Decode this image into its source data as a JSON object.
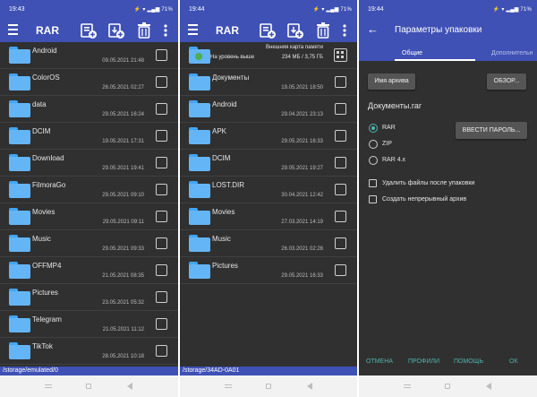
{
  "colors": {
    "primary": "#3f51b5",
    "list_bg": "#303030",
    "accent": "#4db6ac",
    "folder": "#64b5f6"
  },
  "screen1": {
    "status_time": "19:43",
    "status_icons": "⚡ ▾ ▂▄▆ 71%",
    "title": "RAR",
    "toolbar_icons": [
      "menu-icon",
      "add-archive-icon",
      "extract-icon",
      "delete-icon",
      "more-icon"
    ],
    "rows": [
      {
        "name": "Android",
        "date": "09.05.2021 21:48"
      },
      {
        "name": "ColorOS",
        "date": "26.05.2021 02:27"
      },
      {
        "name": "data",
        "date": "29.05.2021 16:24"
      },
      {
        "name": "DCIM",
        "date": "19.05.2021 17:31"
      },
      {
        "name": "Download",
        "date": "29.05.2021 19:41"
      },
      {
        "name": "FilmoraGo",
        "date": "29.05.2021 09:10"
      },
      {
        "name": "Movies",
        "date": "29.05.2021 09:11"
      },
      {
        "name": "Music",
        "date": "29.05.2021 09:33"
      },
      {
        "name": "OFFMP4",
        "date": "21.05.2021 08:35"
      },
      {
        "name": "Pictures",
        "date": "23.05.2021 05:32"
      },
      {
        "name": "Telegram",
        "date": "21.05.2021 11:12"
      },
      {
        "name": "TikTok",
        "date": "28.05.2021 10:18"
      }
    ],
    "path": "/storage/emulated/0"
  },
  "screen2": {
    "status_time": "19:44",
    "status_icons": "⚡ ▾ ▂▄▆ 71%",
    "title": "RAR",
    "sd_title": "Внешняя карта памяти",
    "sd_sub": "На уровень выше",
    "sd_size": "234 МБ / 3,75 ГБ",
    "rows": [
      {
        "name": "Документы",
        "date": "19.05.2021 18:50"
      },
      {
        "name": "Android",
        "date": "29.04.2021 23:13"
      },
      {
        "name": "APK",
        "date": "29.05.2021 16:33"
      },
      {
        "name": "DCIM",
        "date": "29.05.2021 19:27"
      },
      {
        "name": "LOST.DIR",
        "date": "30.04.2021 12:42"
      },
      {
        "name": "Movies",
        "date": "27.03.2021 14:19"
      },
      {
        "name": "Music",
        "date": "26.03.2021 02:28"
      },
      {
        "name": "Pictures",
        "date": "29.05.2021 16:33"
      }
    ],
    "path": "/storage/34AD-0A01"
  },
  "screen3": {
    "status_time": "19:44",
    "status_icons": "⚡ ▾ ▂▄▆ 71%",
    "back_glyph": "←",
    "title": "Параметры упаковки",
    "tab_general": "Общие",
    "tab_extra": "Дополнительн",
    "archive_name_button": "Имя архива",
    "browse_button": "ОБЗОР...",
    "archive_filename": "Документы.rar",
    "formats": [
      {
        "label": "RAR",
        "selected": true
      },
      {
        "label": "ZIP",
        "selected": false
      },
      {
        "label": "RAR 4.x",
        "selected": false
      }
    ],
    "password_button": "ВВЕСТИ ПАРОЛЬ...",
    "options": [
      {
        "label": "Удалить файлы после упаковки",
        "checked": false
      },
      {
        "label": "Создать непрерывный архив",
        "checked": false
      }
    ],
    "actions": {
      "cancel": "ОТМЕНА",
      "profiles": "ПРОФИЛИ",
      "help": "ПОМОЩЬ",
      "ok": "ОК"
    }
  }
}
